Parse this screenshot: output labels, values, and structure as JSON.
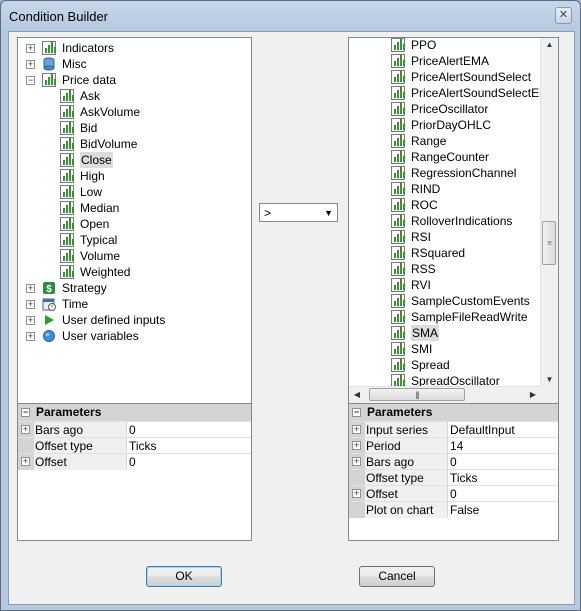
{
  "window": {
    "title": "Condition Builder"
  },
  "left_tree": [
    {
      "label": "Indicators",
      "level": 0,
      "expander": "+",
      "icon": "chart-icon"
    },
    {
      "label": "Misc",
      "level": 0,
      "expander": "+",
      "icon": "database-icon"
    },
    {
      "label": "Price data",
      "level": 0,
      "expander": "−",
      "icon": "chart-icon"
    },
    {
      "label": "Ask",
      "level": 1,
      "icon": "chart-icon"
    },
    {
      "label": "AskVolume",
      "level": 1,
      "icon": "chart-icon"
    },
    {
      "label": "Bid",
      "level": 1,
      "icon": "chart-icon"
    },
    {
      "label": "BidVolume",
      "level": 1,
      "icon": "chart-icon"
    },
    {
      "label": "Close",
      "level": 1,
      "icon": "chart-icon",
      "selected": true
    },
    {
      "label": "High",
      "level": 1,
      "icon": "chart-icon"
    },
    {
      "label": "Low",
      "level": 1,
      "icon": "chart-icon"
    },
    {
      "label": "Median",
      "level": 1,
      "icon": "chart-icon"
    },
    {
      "label": "Open",
      "level": 1,
      "icon": "chart-icon"
    },
    {
      "label": "Typical",
      "level": 1,
      "icon": "chart-icon"
    },
    {
      "label": "Volume",
      "level": 1,
      "icon": "chart-icon"
    },
    {
      "label": "Weighted",
      "level": 1,
      "icon": "chart-icon"
    },
    {
      "label": "Strategy",
      "level": 0,
      "expander": "+",
      "icon": "dollar-icon"
    },
    {
      "label": "Time",
      "level": 0,
      "expander": "+",
      "icon": "calendar-icon"
    },
    {
      "label": "User defined inputs",
      "level": 0,
      "expander": "+",
      "icon": "play-icon"
    },
    {
      "label": "User variables",
      "level": 0,
      "expander": "+",
      "icon": "globe-icon"
    }
  ],
  "operator": {
    "value": ">"
  },
  "right_list": [
    "PPO",
    "PriceAlertEMA",
    "PriceAlertSoundSelect",
    "PriceAlertSoundSelectEMA",
    "PriceOscillator",
    "PriorDayOHLC",
    "Range",
    "RangeCounter",
    "RegressionChannel",
    "RIND",
    "ROC",
    "RolloverIndications",
    "RSI",
    "RSquared",
    "RSS",
    "RVI",
    "SampleCustomEvents",
    "SampleFileReadWrite",
    "SMA",
    "SMI",
    "Spread",
    "SpreadOscillator"
  ],
  "right_selected": "SMA",
  "left_params": {
    "header": "Parameters",
    "rows": [
      {
        "name": "Bars ago",
        "value": "0",
        "expander": true
      },
      {
        "name": "Offset type",
        "value": "Ticks",
        "expander": false
      },
      {
        "name": "Offset",
        "value": "0",
        "expander": true
      }
    ]
  },
  "right_params": {
    "header": "Parameters",
    "rows": [
      {
        "name": "Input series",
        "value": "DefaultInput",
        "expander": true
      },
      {
        "name": "Period",
        "value": "14",
        "expander": true
      },
      {
        "name": "Bars ago",
        "value": "0",
        "expander": true
      },
      {
        "name": "Offset type",
        "value": "Ticks",
        "expander": false
      },
      {
        "name": "Offset",
        "value": "0",
        "expander": true
      },
      {
        "name": "Plot on chart",
        "value": "False",
        "expander": false
      }
    ]
  },
  "buttons": {
    "ok": "OK",
    "cancel": "Cancel"
  },
  "colors": {
    "accent": "#3c7fb1",
    "chart_green": "#3a8f3a",
    "selection": "#dcdcdc"
  }
}
